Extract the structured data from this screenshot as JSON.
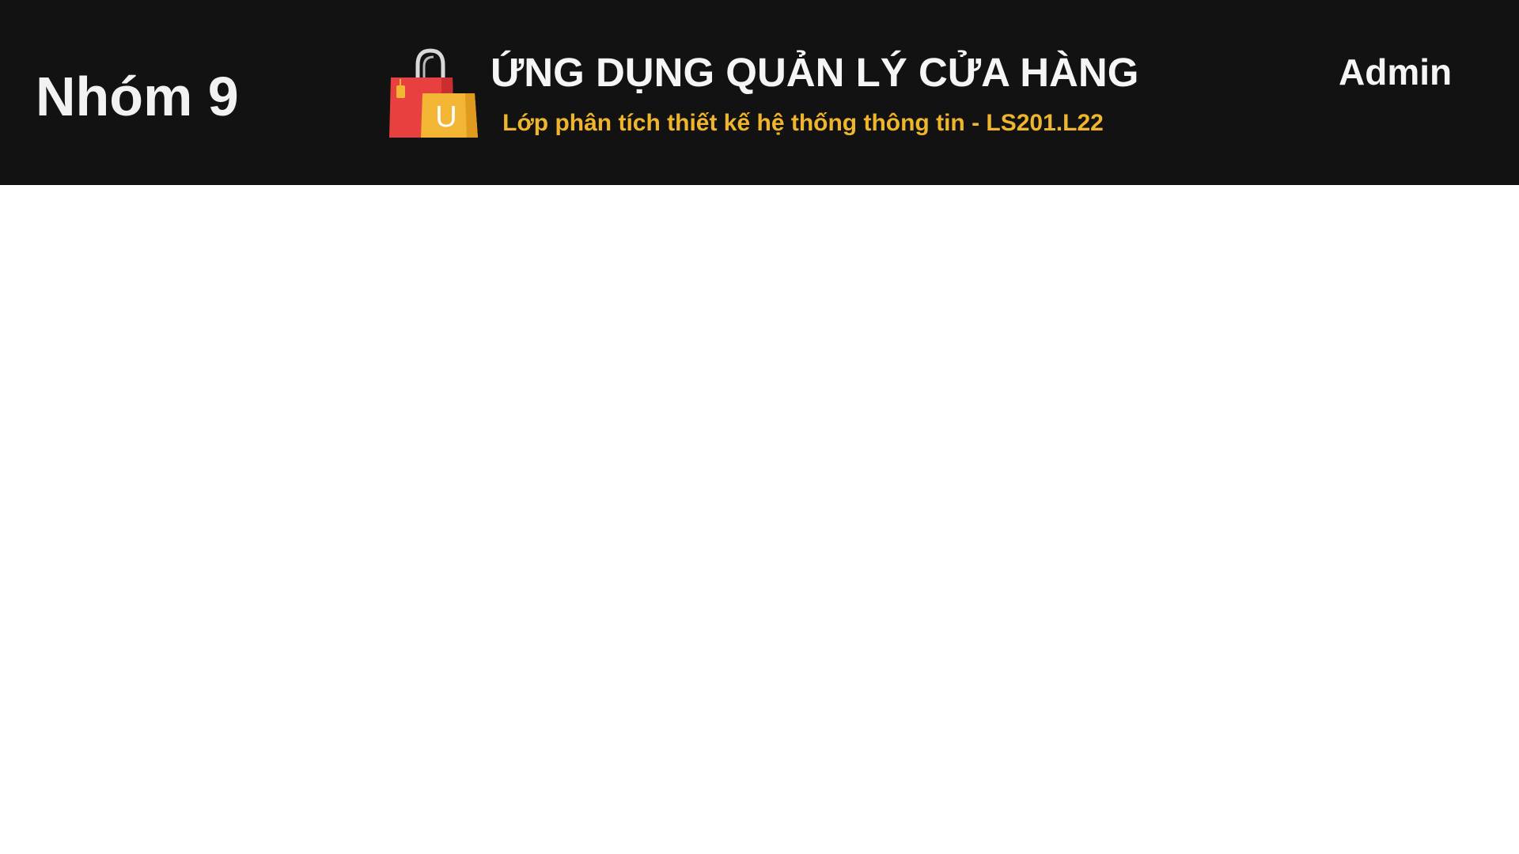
{
  "header": {
    "group_name": "Nhóm 9",
    "logo_icon": "shopping-bags-icon",
    "logo_letter": "U",
    "title": "ỨNG DỤNG QUẢN LÝ CỬA HÀNG",
    "subtitle": "Lớp phân tích thiết kế hệ thống thông tin - LS201.L22",
    "user": "Admin"
  },
  "colors": {
    "header_background": "#121212",
    "title_text": "#f5f5f5",
    "subtitle_text": "#efb52c",
    "page_background": "#ffffff"
  }
}
